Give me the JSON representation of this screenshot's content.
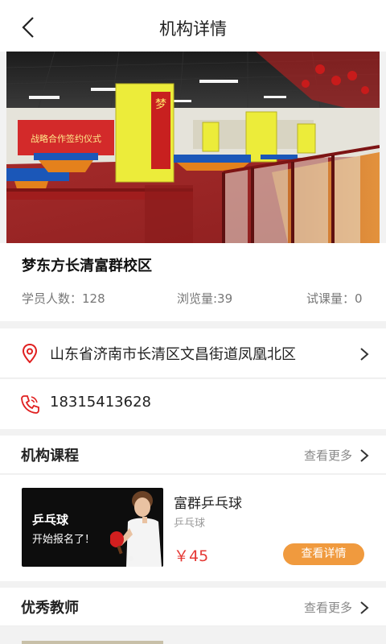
{
  "header": {
    "title": "机构详情"
  },
  "banner": {
    "slide_count": 3,
    "active_index": 2,
    "banner_sign": "战略合作签约仪式",
    "pillar_char": "梦"
  },
  "school": {
    "name": "梦东方长清富群校区",
    "students": "学员人数：128",
    "views": "浏览量:39",
    "trials": "试课量：0"
  },
  "contact": {
    "address": "山东省济南市长清区文昌街道凤凰北区",
    "phone": "18315413628"
  },
  "courses_section": {
    "title": "机构课程",
    "more_label": "查看更多"
  },
  "course": {
    "thumb_title": "乒乓球",
    "thumb_subtitle": "开始报名了！",
    "name": "富群乒乓球",
    "category": "乒乓球",
    "price": "￥45",
    "detail_label": "查看详情"
  },
  "teachers_section": {
    "title": "优秀教师",
    "more_label": "查看更多"
  },
  "colors": {
    "accent_red": "#e02020",
    "price_red": "#e53935",
    "button_orange": "#f09a3e"
  }
}
